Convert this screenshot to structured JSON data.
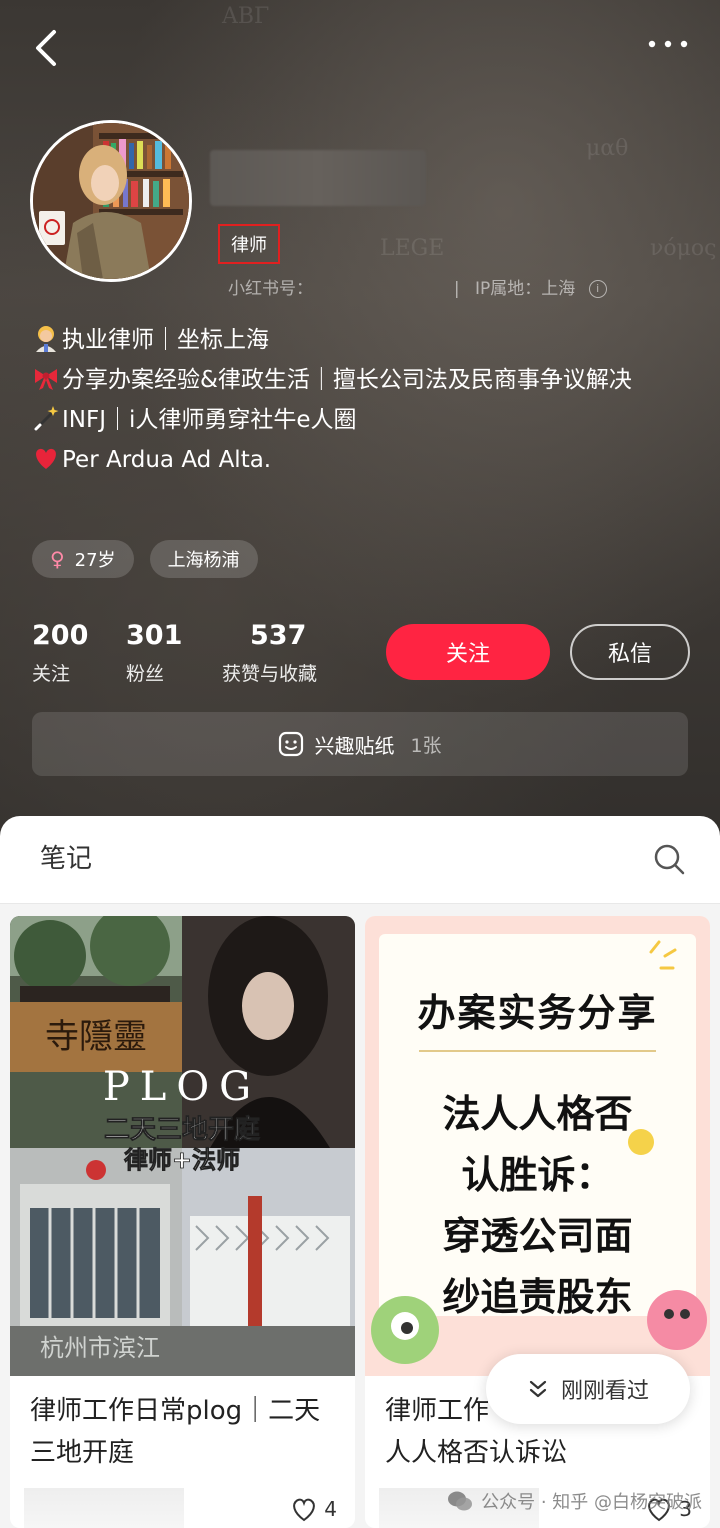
{
  "profile": {
    "tag": "律师",
    "id_label": "小红书号：",
    "ip_label": "IP属地：上海",
    "bio": [
      "执业律师｜坐标上海",
      "分享办案经验&律政生活｜擅长公司法及民商事争议解决",
      "INFJ｜i人律师勇穿社牛e人圈",
      "Per Ardua Ad Alta."
    ],
    "chips": [
      "27岁",
      "上海杨浦"
    ],
    "gender_symbol": "♀"
  },
  "stats": [
    {
      "num": "200",
      "label": "关注"
    },
    {
      "num": "301",
      "label": "粉丝"
    },
    {
      "num": "537",
      "label": "获赞与收藏"
    }
  ],
  "buttons": {
    "follow": "关注",
    "message": "私信"
  },
  "sticker_bar": {
    "label": "兴趣贴纸",
    "count": "1张"
  },
  "tabs": {
    "notes": "笔记"
  },
  "cards": [
    {
      "title": "律师工作日常plog｜二天三地开庭",
      "likes": "4",
      "image_text": [
        "PLOG",
        "二天三地开庭",
        "律师+法师",
        "寺隱靈",
        "杭州市滨江"
      ]
    },
    {
      "title": "律师工作...人人格否认诉讼",
      "title_line1": "律师工作",
      "title_line2": "人人格否认诉讼",
      "likes": "3",
      "image_text": [
        "办案实务分享",
        "法人人格否",
        "认胜诉：",
        "穿透公司面",
        "纱追责股东"
      ]
    }
  ],
  "recently_viewed": "刚刚看过",
  "watermark": "公众号 · 知乎 @白杨突破派",
  "colors": {
    "accent": "#ff2442",
    "tag_border": "#e02020"
  }
}
